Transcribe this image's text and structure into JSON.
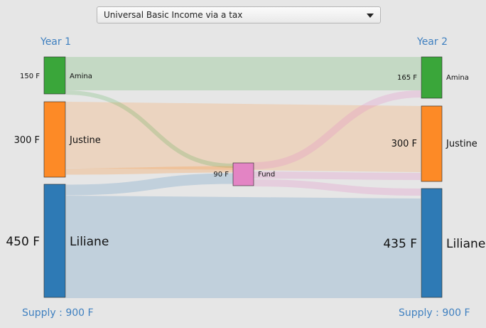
{
  "selector": {
    "value": "Universal Basic Income via a tax"
  },
  "columns": {
    "left": "Year 1",
    "right": "Year 2"
  },
  "supply": {
    "left": "Supply : 900 F",
    "right": "Supply : 900 F"
  },
  "fund": {
    "name": "Fund",
    "value": "90 F"
  },
  "year1": [
    {
      "name": "Amina",
      "value": "150 F"
    },
    {
      "name": "Justine",
      "value": "300 F"
    },
    {
      "name": "Liliane",
      "value": "450 F"
    }
  ],
  "year2": [
    {
      "name": "Amina",
      "value": "165 F"
    },
    {
      "name": "Justine",
      "value": "300 F"
    },
    {
      "name": "Liliane",
      "value": "435 F"
    }
  ],
  "colors": {
    "amina": "#3aa63a",
    "justine": "#fd8a26",
    "liliane": "#2e7ab5",
    "fund": "#e384c4",
    "accent": "#3f80c0"
  }
}
